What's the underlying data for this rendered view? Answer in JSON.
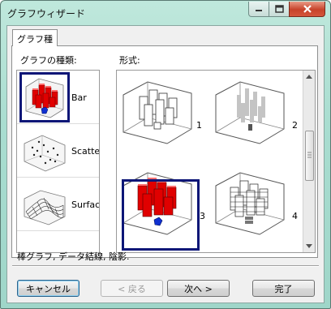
{
  "window": {
    "title": "グラフウィザード",
    "controls": {
      "minimize": "minimize",
      "maximize": "maximize",
      "close": "close"
    }
  },
  "tab": {
    "label": "グラフ種"
  },
  "chart_type_section": {
    "label": "グラフの種類:",
    "items": [
      {
        "label": "Bar",
        "icon": "bar-3d-icon",
        "selected": true
      },
      {
        "label": "Scatter",
        "icon": "scatter-3d-icon",
        "selected": false
      },
      {
        "label": "Surface",
        "icon": "surface-3d-icon",
        "selected": false
      }
    ]
  },
  "format_section": {
    "label": "形式:",
    "options": [
      {
        "number": "1",
        "icon": "bar-white-icon",
        "selected": false
      },
      {
        "number": "2",
        "icon": "bar-gray-icon",
        "selected": false
      },
      {
        "number": "3",
        "icon": "bar-red-shaded-icon",
        "selected": true
      },
      {
        "number": "4",
        "icon": "bar-gridline-icon",
        "selected": false
      }
    ]
  },
  "description": "棒グラフ, データ結線, 陰影.",
  "buttons": {
    "cancel": "キャンセル",
    "back": "< 戻る",
    "next": "次へ >",
    "finish": "完了"
  },
  "colors": {
    "selection": "#0d1677",
    "bar_red": "#e00000",
    "marker_blue": "#1030d0",
    "close_button": "#c7432a"
  }
}
